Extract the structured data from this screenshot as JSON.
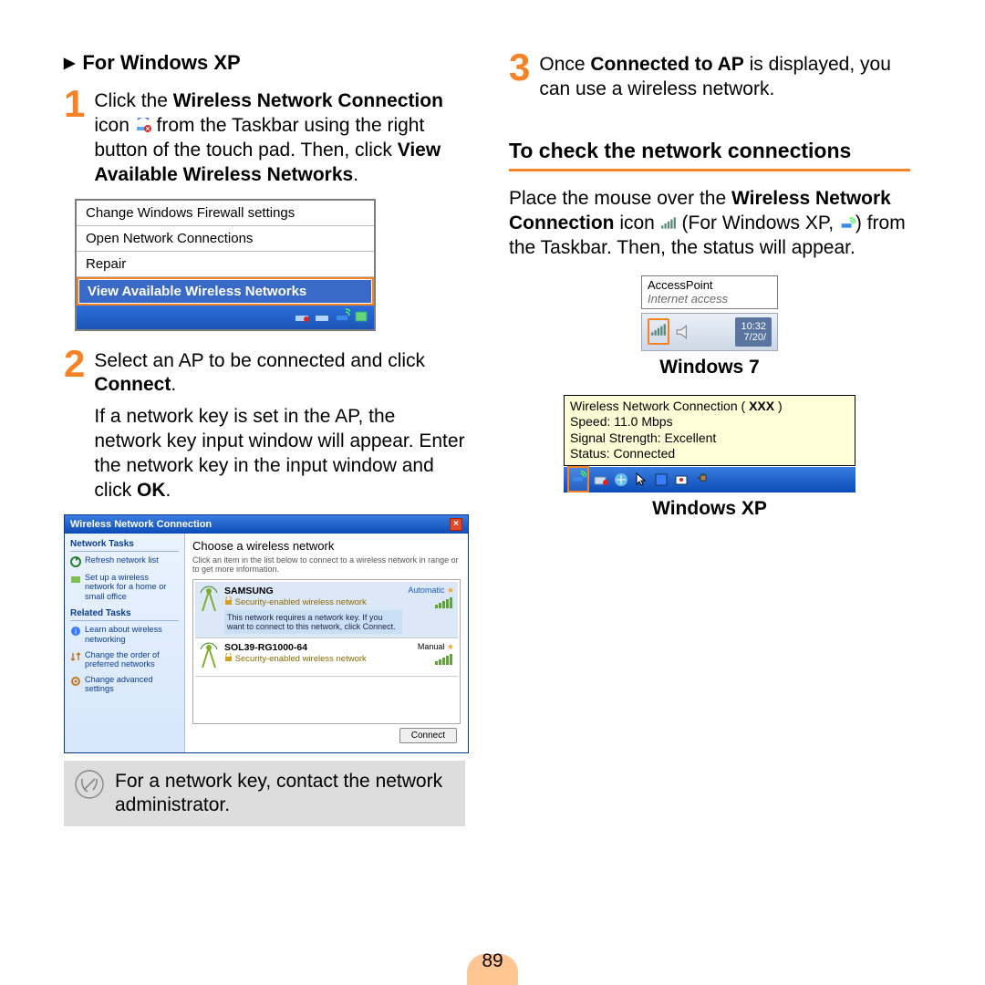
{
  "page_number": "89",
  "left": {
    "heading": "For Windows XP",
    "step1": {
      "num": "1",
      "p1a": "Click the ",
      "p1b": "Wireless Network Connection",
      "p1c": " icon ",
      "p1d": " from the Taskbar using the right button of the touch pad. Then, click ",
      "p1e": "View Available Wireless Networks",
      "p1f": "."
    },
    "cmenu": {
      "i1": "Change Windows Firewall settings",
      "i2": "Open Network Connections",
      "i3": "Repair",
      "i4": "View Available Wireless Networks"
    },
    "step2": {
      "num": "2",
      "p1": "Select an AP to be connected and click ",
      "p1b": "Connect",
      "p1c": ".",
      "p2": "If a network key is set in the AP, the network key input window will appear. Enter the network key in the input window and click ",
      "p2b": "OK",
      "p2c": "."
    },
    "wlan": {
      "title": "Wireless Network Connection",
      "side_h1": "Network Tasks",
      "side_i1": "Refresh network list",
      "side_i2": "Set up a wireless network for a home or small office",
      "side_h2": "Related Tasks",
      "side_i3": "Learn about wireless networking",
      "side_i4": "Change the order of preferred networks",
      "side_i5": "Change advanced settings",
      "main_h": "Choose a wireless network",
      "main_sub": "Click an item in the list below to connect to a wireless network in range or to get more information.",
      "ap1_name": "SAMSUNG",
      "ap1_sec": "Security-enabled wireless network",
      "ap1_desc": "This network requires a network key. If you want to connect to this network, click Connect.",
      "ap1_mode": "Automatic",
      "ap2_name": "SOL39-RG1000-64",
      "ap2_sec": "Security-enabled wireless network",
      "ap2_mode": "Manual",
      "connect": "Connect"
    },
    "note": "For a network key, contact the network administrator."
  },
  "right": {
    "step3": {
      "num": "3",
      "p1": "Once ",
      "p1b": "Connected to AP",
      "p1c": " is displayed, you can use a wireless network."
    },
    "sec_hdr": "To check the network connections",
    "para": {
      "a": "Place the mouse over the ",
      "b": "Wireless Network Connection",
      "c": " icon ",
      "d": " (For Windows XP, ",
      "e": ") from the Taskbar. Then, the status will appear."
    },
    "w7_tip_name": "AccessPoint",
    "w7_tip_sub": "Internet access",
    "w7_time1": "10:32",
    "w7_time2": "7/20/",
    "cap7": "Windows 7",
    "xp_tip_l1a": "Wireless Network Connection ( ",
    "xp_tip_l1b": "XXX",
    "xp_tip_l1c": " )",
    "xp_tip_l2": "Speed: 11.0 Mbps",
    "xp_tip_l3": "Signal Strength: Excellent",
    "xp_tip_l4": "Status: Connected",
    "capxp": "Windows XP"
  }
}
